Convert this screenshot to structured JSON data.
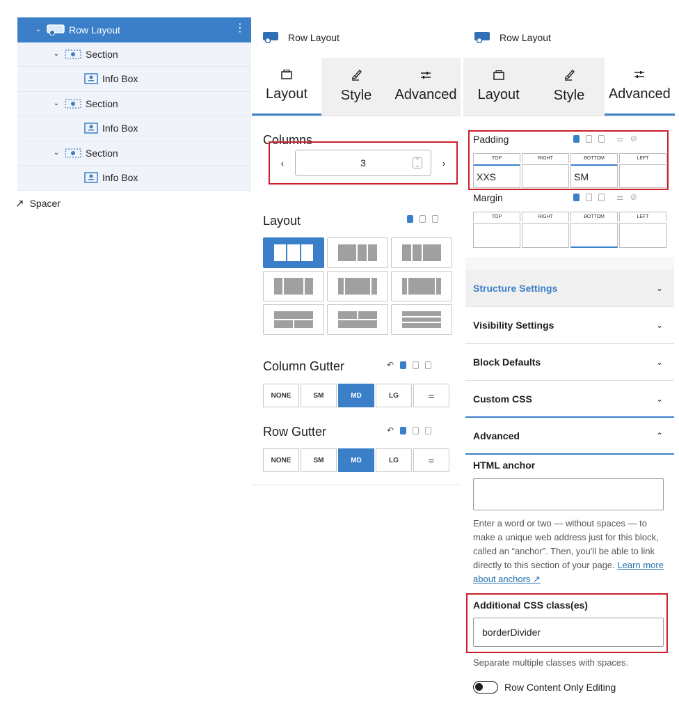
{
  "tree": {
    "items": [
      {
        "label": "Row Layout",
        "selected": true
      },
      {
        "label": "Section"
      },
      {
        "label": "Info Box"
      },
      {
        "label": "Section"
      },
      {
        "label": "Info Box"
      },
      {
        "label": "Section"
      },
      {
        "label": "Info Box"
      }
    ],
    "spacer": "Spacer"
  },
  "mid": {
    "block_title": "Row Layout",
    "tabs": [
      {
        "label": "Layout",
        "active": true
      },
      {
        "label": "Style"
      },
      {
        "label": "Advanced"
      }
    ],
    "columns_label": "Columns",
    "columns_value": "3",
    "prev_arrow": "‹",
    "next_arrow": "›",
    "layout_label": "Layout",
    "column_gutter_label": "Column Gutter",
    "row_gutter_label": "Row Gutter",
    "gutter_options": [
      "NONE",
      "SM",
      "MD",
      "LG"
    ],
    "gutter_selected": "MD"
  },
  "right": {
    "block_title": "Row Layout",
    "tabs": [
      {
        "label": "Layout"
      },
      {
        "label": "Style"
      },
      {
        "label": "Advanced",
        "active": true
      }
    ],
    "padding_label": "Padding",
    "margin_label": "Margin",
    "side_labels": [
      "TOP",
      "RIGHT",
      "BOTTOM",
      "LEFT"
    ],
    "padding_values": [
      "XXS",
      "",
      "SM",
      ""
    ],
    "margin_values": [
      "",
      "",
      "",
      ""
    ],
    "accordion": [
      "Structure Settings",
      "Visibility Settings",
      "Block Defaults",
      "Custom CSS",
      "Advanced"
    ],
    "html_anchor_label": "HTML anchor",
    "html_anchor_help": "Enter a word or two — without spaces — to make a unique web address just for this block, called an “anchor”. Then, you'll be able to link directly to this section of your page.",
    "learn_more": "Learn more about anchors ↗",
    "css_class_label": "Additional CSS class(es)",
    "css_class_value": "borderDivider",
    "css_class_help": "Separate multiple classes with spaces.",
    "toggle_label": "Row Content Only Editing"
  },
  "colors": {
    "accent": "#3a7fc7",
    "highlight": "#cc1f2a"
  }
}
